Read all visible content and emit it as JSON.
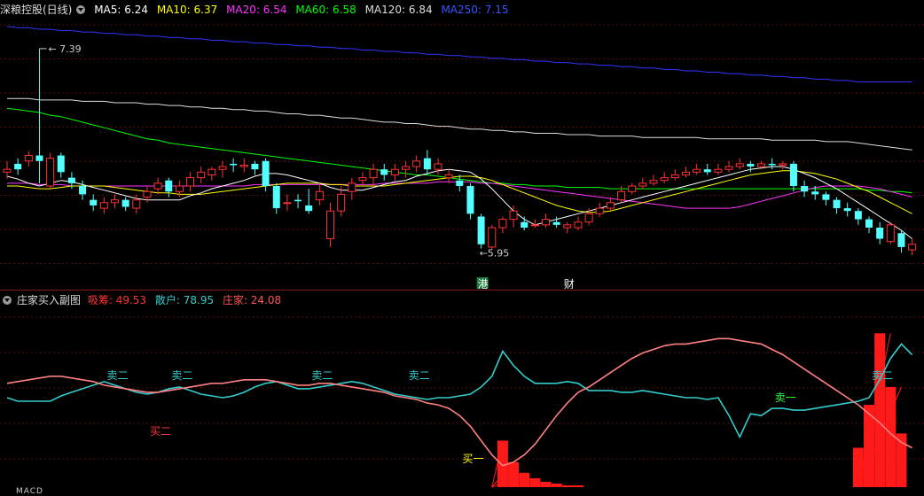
{
  "main": {
    "title": "深粮控股(日线)",
    "ma": [
      {
        "label": "MA5: 6.24",
        "color": "#ffffff"
      },
      {
        "label": "MA10: 6.37",
        "color": "#ffff00"
      },
      {
        "label": "MA20: 6.54",
        "color": "#ff33ff"
      },
      {
        "label": "MA60: 6.58",
        "color": "#00ff00"
      },
      {
        "label": "MA120: 6.84",
        "color": "#dddddd"
      },
      {
        "label": "MA250: 7.15",
        "color": "#3333ff"
      }
    ],
    "high_label": "7.39",
    "low_label": "5.95",
    "markers": [
      {
        "text": "港",
        "color": "#ffffff",
        "bg": "#1a7a3a"
      },
      {
        "text": "财",
        "color": "#ffffff",
        "bg": "#000000"
      }
    ]
  },
  "sub": {
    "title": "庄家买入副图",
    "values": [
      {
        "label": "吸筹: 49.53",
        "color": "#ff3333"
      },
      {
        "label": "散户: 78.95",
        "color": "#33cccc"
      },
      {
        "label": "庄家: 24.08",
        "color": "#ff5555"
      }
    ],
    "signals": [
      {
        "text": "卖二",
        "color": "#33cccc"
      },
      {
        "text": "卖二",
        "color": "#33cccc"
      },
      {
        "text": "卖二",
        "color": "#33cccc"
      },
      {
        "text": "卖二",
        "color": "#33cccc"
      },
      {
        "text": "卖二",
        "color": "#33cccc"
      },
      {
        "text": "卖一",
        "color": "#33ff33"
      },
      {
        "text": "买二",
        "color": "#ff3333"
      },
      {
        "text": "买一",
        "color": "#ffff00"
      }
    ]
  },
  "bottom_strip": "MACD",
  "chart_data": {
    "type": "candlestick",
    "ylim": [
      5.8,
      7.6
    ],
    "candles": [
      [
        6.5,
        6.52,
        6.58,
        6.45
      ],
      [
        6.56,
        6.52,
        6.6,
        6.48
      ],
      [
        6.58,
        6.62,
        6.65,
        6.54
      ],
      [
        6.62,
        6.58,
        7.39,
        6.42
      ],
      [
        6.4,
        6.6,
        6.64,
        6.38
      ],
      [
        6.62,
        6.5,
        6.64,
        6.46
      ],
      [
        6.46,
        6.42,
        6.5,
        6.38
      ],
      [
        6.4,
        6.34,
        6.44,
        6.3
      ],
      [
        6.3,
        6.26,
        6.34,
        6.22
      ],
      [
        6.24,
        6.28,
        6.32,
        6.2
      ],
      [
        6.28,
        6.3,
        6.34,
        6.24
      ],
      [
        6.3,
        6.25,
        6.32,
        6.22
      ],
      [
        6.24,
        6.3,
        6.34,
        6.2
      ],
      [
        6.32,
        6.36,
        6.4,
        6.28
      ],
      [
        6.38,
        6.42,
        6.46,
        6.34
      ],
      [
        6.44,
        6.36,
        6.46,
        6.32
      ],
      [
        6.36,
        6.4,
        6.44,
        6.32
      ],
      [
        6.4,
        6.46,
        6.5,
        6.36
      ],
      [
        6.46,
        6.5,
        6.54,
        6.42
      ],
      [
        6.48,
        6.52,
        6.54,
        6.44
      ],
      [
        6.52,
        6.54,
        6.58,
        6.46
      ],
      [
        6.56,
        6.55,
        6.6,
        6.5
      ],
      [
        6.54,
        6.55,
        6.6,
        6.5
      ],
      [
        6.56,
        6.52,
        6.58,
        6.48
      ],
      [
        6.58,
        6.4,
        6.6,
        6.36
      ],
      [
        6.4,
        6.24,
        6.42,
        6.2
      ],
      [
        6.28,
        6.28,
        6.34,
        6.22
      ],
      [
        6.3,
        6.29,
        6.34,
        6.24
      ],
      [
        6.26,
        6.22,
        6.38,
        6.2
      ],
      [
        6.3,
        6.36,
        6.42,
        6.26
      ],
      [
        6.02,
        6.22,
        6.28,
        5.96
      ],
      [
        6.22,
        6.34,
        6.4,
        6.18
      ],
      [
        6.36,
        6.42,
        6.46,
        6.3
      ],
      [
        6.44,
        6.46,
        6.5,
        6.4
      ],
      [
        6.46,
        6.52,
        6.56,
        6.4
      ],
      [
        6.52,
        6.48,
        6.56,
        6.44
      ],
      [
        6.48,
        6.52,
        6.56,
        6.44
      ],
      [
        6.52,
        6.54,
        6.58,
        6.46
      ],
      [
        6.54,
        6.58,
        6.62,
        6.5
      ],
      [
        6.6,
        6.52,
        6.66,
        6.48
      ],
      [
        6.52,
        6.56,
        6.6,
        6.48
      ],
      [
        6.46,
        6.48,
        6.52,
        6.42
      ],
      [
        6.44,
        6.4,
        6.48,
        6.36
      ],
      [
        6.4,
        6.2,
        6.42,
        6.16
      ],
      [
        6.18,
        5.98,
        6.2,
        5.95
      ],
      [
        5.96,
        6.1,
        6.12,
        5.94
      ],
      [
        6.1,
        6.16,
        6.18,
        6.06
      ],
      [
        6.16,
        6.22,
        6.26,
        6.1
      ],
      [
        6.14,
        6.1,
        6.18,
        6.08
      ],
      [
        6.12,
        6.12,
        6.16,
        6.1
      ],
      [
        6.12,
        6.16,
        6.2,
        6.1
      ],
      [
        6.14,
        6.12,
        6.18,
        6.1
      ],
      [
        6.1,
        6.12,
        6.14,
        6.06
      ],
      [
        6.1,
        6.14,
        6.18,
        6.08
      ],
      [
        6.14,
        6.2,
        6.24,
        6.12
      ],
      [
        6.2,
        6.24,
        6.28,
        6.18
      ],
      [
        6.24,
        6.28,
        6.32,
        6.22
      ],
      [
        6.3,
        6.36,
        6.4,
        6.28
      ],
      [
        6.36,
        6.4,
        6.42,
        6.34
      ],
      [
        6.4,
        6.42,
        6.46,
        6.38
      ],
      [
        6.42,
        6.44,
        6.48,
        6.4
      ],
      [
        6.44,
        6.46,
        6.5,
        6.42
      ],
      [
        6.46,
        6.48,
        6.52,
        6.44
      ],
      [
        6.48,
        6.5,
        6.54,
        6.46
      ],
      [
        6.5,
        6.52,
        6.56,
        6.48
      ],
      [
        6.52,
        6.5,
        6.56,
        6.48
      ],
      [
        6.5,
        6.52,
        6.56,
        6.48
      ],
      [
        6.52,
        6.54,
        6.58,
        6.5
      ],
      [
        6.54,
        6.56,
        6.6,
        6.52
      ],
      [
        6.56,
        6.54,
        6.58,
        6.5
      ],
      [
        6.54,
        6.56,
        6.58,
        6.52
      ],
      [
        6.56,
        6.55,
        6.6,
        6.52
      ],
      [
        6.55,
        6.56,
        6.58,
        6.52
      ],
      [
        6.56,
        6.4,
        6.58,
        6.36
      ],
      [
        6.4,
        6.36,
        6.44,
        6.32
      ],
      [
        6.36,
        6.34,
        6.4,
        6.3
      ],
      [
        6.34,
        6.3,
        6.36,
        6.26
      ],
      [
        6.3,
        6.24,
        6.32,
        6.2
      ],
      [
        6.24,
        6.22,
        6.28,
        6.18
      ],
      [
        6.22,
        6.16,
        6.24,
        6.12
      ],
      [
        6.16,
        6.1,
        6.18,
        6.06
      ],
      [
        6.1,
        6.02,
        6.14,
        5.98
      ],
      [
        6.0,
        6.12,
        6.14,
        5.98
      ],
      [
        6.06,
        5.96,
        6.08,
        5.92
      ],
      [
        5.94,
        5.98,
        6.02,
        5.9
      ]
    ],
    "ma_series": [
      {
        "name": "MA5",
        "color": "#ffffff",
        "values": [
          6.47,
          6.45,
          6.42,
          6.4,
          6.42,
          6.44,
          6.43,
          6.41,
          6.39,
          6.37,
          6.35,
          6.33,
          6.31,
          6.3,
          6.3,
          6.3,
          6.3,
          6.33,
          6.35,
          6.38,
          6.4,
          6.42,
          6.44,
          6.47,
          6.49,
          6.49,
          6.48,
          6.46,
          6.44,
          6.42,
          6.39,
          6.37,
          6.37,
          6.37,
          6.39,
          6.41,
          6.43,
          6.44,
          6.47,
          6.49,
          6.51,
          6.52,
          6.51,
          6.5,
          6.45,
          6.38,
          6.3,
          6.22,
          6.16,
          6.12,
          6.14,
          6.16,
          6.18,
          6.2,
          6.22,
          6.24,
          6.26,
          6.28,
          6.3,
          6.32,
          6.34,
          6.36,
          6.38,
          6.4,
          6.42,
          6.44,
          6.46,
          6.48,
          6.5,
          6.52,
          6.53,
          6.54,
          6.54,
          6.52,
          6.49,
          6.46,
          6.42,
          6.38,
          6.33,
          6.28,
          6.23,
          6.18,
          6.13,
          6.08,
          6.02
        ]
      },
      {
        "name": "MA10",
        "color": "#ffff00",
        "values": [
          6.4,
          6.4,
          6.39,
          6.38,
          6.38,
          6.39,
          6.4,
          6.4,
          6.4,
          6.4,
          6.39,
          6.38,
          6.37,
          6.36,
          6.35,
          6.35,
          6.34,
          6.34,
          6.34,
          6.35,
          6.36,
          6.37,
          6.38,
          6.39,
          6.4,
          6.41,
          6.42,
          6.42,
          6.42,
          6.42,
          6.41,
          6.41,
          6.4,
          6.4,
          6.4,
          6.4,
          6.41,
          6.42,
          6.43,
          6.44,
          6.45,
          6.46,
          6.47,
          6.47,
          6.46,
          6.44,
          6.41,
          6.38,
          6.35,
          6.32,
          6.29,
          6.26,
          6.24,
          6.22,
          6.21,
          6.21,
          6.22,
          6.24,
          6.26,
          6.28,
          6.3,
          6.32,
          6.34,
          6.36,
          6.38,
          6.4,
          6.42,
          6.44,
          6.46,
          6.48,
          6.49,
          6.5,
          6.51,
          6.51,
          6.5,
          6.49,
          6.47,
          6.45,
          6.42,
          6.39,
          6.36,
          6.32,
          6.28,
          6.24,
          6.2
        ]
      },
      {
        "name": "MA20",
        "color": "#ff33ff",
        "values": [
          6.42,
          6.42,
          6.42,
          6.41,
          6.41,
          6.41,
          6.4,
          6.4,
          6.4,
          6.4,
          6.4,
          6.4,
          6.4,
          6.4,
          6.4,
          6.4,
          6.4,
          6.4,
          6.4,
          6.4,
          6.4,
          6.4,
          6.4,
          6.41,
          6.41,
          6.41,
          6.41,
          6.41,
          6.41,
          6.41,
          6.41,
          6.41,
          6.41,
          6.41,
          6.41,
          6.42,
          6.42,
          6.42,
          6.42,
          6.42,
          6.43,
          6.43,
          6.43,
          6.43,
          6.42,
          6.42,
          6.41,
          6.4,
          6.39,
          6.38,
          6.37,
          6.36,
          6.35,
          6.34,
          6.33,
          6.32,
          6.31,
          6.3,
          6.29,
          6.28,
          6.27,
          6.26,
          6.25,
          6.24,
          6.24,
          6.24,
          6.24,
          6.24,
          6.25,
          6.27,
          6.29,
          6.31,
          6.33,
          6.35,
          6.37,
          6.39,
          6.4,
          6.4,
          6.4,
          6.4,
          6.39,
          6.38,
          6.36,
          6.34,
          6.32
        ]
      },
      {
        "name": "MA60",
        "color": "#00ff00",
        "values": [
          6.96,
          6.95,
          6.94,
          6.93,
          6.91,
          6.9,
          6.88,
          6.86,
          6.84,
          6.82,
          6.8,
          6.78,
          6.76,
          6.74,
          6.73,
          6.71,
          6.7,
          6.69,
          6.68,
          6.67,
          6.66,
          6.65,
          6.64,
          6.63,
          6.62,
          6.61,
          6.6,
          6.59,
          6.58,
          6.57,
          6.56,
          6.55,
          6.54,
          6.53,
          6.52,
          6.51,
          6.5,
          6.49,
          6.48,
          6.48,
          6.47,
          6.46,
          6.45,
          6.44,
          6.43,
          6.42,
          6.42,
          6.41,
          6.41,
          6.4,
          6.4,
          6.4,
          6.39,
          6.39,
          6.39,
          6.39,
          6.38,
          6.38,
          6.38,
          6.38,
          6.38,
          6.38,
          6.38,
          6.38,
          6.38,
          6.38,
          6.38,
          6.38,
          6.38,
          6.38,
          6.38,
          6.38,
          6.38,
          6.38,
          6.38,
          6.38,
          6.38,
          6.38,
          6.38,
          6.38,
          6.37,
          6.37,
          6.36,
          6.36,
          6.35
        ]
      },
      {
        "name": "MA120",
        "color": "#dddddd",
        "values": [
          7.03,
          7.03,
          7.03,
          7.02,
          7.02,
          7.02,
          7.02,
          7.01,
          7.01,
          7.01,
          7.0,
          7.0,
          7.0,
          6.99,
          6.99,
          6.98,
          6.98,
          6.97,
          6.97,
          6.96,
          6.96,
          6.95,
          6.95,
          6.94,
          6.94,
          6.93,
          6.92,
          6.92,
          6.91,
          6.91,
          6.9,
          6.89,
          6.89,
          6.88,
          6.87,
          6.86,
          6.86,
          6.85,
          6.85,
          6.84,
          6.83,
          6.83,
          6.82,
          6.81,
          6.81,
          6.8,
          6.8,
          6.79,
          6.79,
          6.78,
          6.78,
          6.78,
          6.77,
          6.77,
          6.77,
          6.76,
          6.76,
          6.76,
          6.76,
          6.75,
          6.75,
          6.75,
          6.75,
          6.75,
          6.75,
          6.74,
          6.74,
          6.74,
          6.74,
          6.74,
          6.74,
          6.73,
          6.73,
          6.73,
          6.73,
          6.73,
          6.72,
          6.72,
          6.72,
          6.71,
          6.7,
          6.69,
          6.68,
          6.67,
          6.66
        ]
      },
      {
        "name": "MA250",
        "color": "#3333ff",
        "values": [
          7.55,
          7.54,
          7.54,
          7.53,
          7.53,
          7.52,
          7.52,
          7.51,
          7.51,
          7.5,
          7.5,
          7.49,
          7.49,
          7.48,
          7.48,
          7.47,
          7.47,
          7.46,
          7.46,
          7.45,
          7.45,
          7.44,
          7.44,
          7.43,
          7.43,
          7.42,
          7.42,
          7.41,
          7.41,
          7.4,
          7.4,
          7.39,
          7.39,
          7.38,
          7.38,
          7.37,
          7.37,
          7.36,
          7.36,
          7.35,
          7.35,
          7.34,
          7.34,
          7.33,
          7.33,
          7.32,
          7.32,
          7.31,
          7.31,
          7.3,
          7.3,
          7.29,
          7.29,
          7.28,
          7.28,
          7.27,
          7.27,
          7.26,
          7.26,
          7.25,
          7.25,
          7.24,
          7.24,
          7.23,
          7.23,
          7.22,
          7.22,
          7.21,
          7.21,
          7.2,
          7.2,
          7.19,
          7.19,
          7.18,
          7.18,
          7.17,
          7.17,
          7.16,
          7.16,
          7.15,
          7.15,
          7.15,
          7.15,
          7.15,
          7.15
        ]
      }
    ],
    "sub_ylim": [
      0,
      100
    ],
    "sanhu": [
      50,
      48,
      48,
      48,
      48,
      51,
      53,
      55,
      57,
      59,
      57,
      55,
      53,
      52,
      53,
      55,
      56,
      54,
      52,
      51,
      50,
      51,
      53,
      56,
      58,
      59,
      57,
      55,
      55,
      56,
      57,
      58,
      59,
      58,
      56,
      54,
      52,
      51,
      50,
      49,
      50,
      50,
      51,
      52,
      56,
      62,
      76,
      68,
      62,
      58,
      58,
      58,
      59,
      58,
      54,
      54,
      54,
      53,
      53,
      54,
      53,
      52,
      51,
      50,
      50,
      49,
      50,
      40,
      28,
      41,
      40,
      44,
      44,
      43,
      43,
      44,
      45,
      46,
      47,
      48,
      50,
      60,
      72,
      80,
      74
    ],
    "zhuangjia": [
      58,
      59,
      60,
      61,
      62,
      62,
      61,
      60,
      59,
      57,
      56,
      55,
      54,
      53,
      53,
      54,
      55,
      56,
      57,
      58,
      58,
      59,
      60,
      60,
      60,
      59,
      58,
      57,
      57,
      58,
      58,
      57,
      56,
      55,
      54,
      53,
      51,
      50,
      49,
      47,
      46,
      44,
      40,
      34,
      26,
      18,
      12,
      14,
      18,
      24,
      32,
      40,
      47,
      53,
      56,
      60,
      64,
      68,
      72,
      75,
      77,
      79,
      80,
      80,
      81,
      82,
      83,
      83,
      82,
      81,
      80,
      77,
      74,
      70,
      66,
      62,
      58,
      54,
      50,
      46,
      41,
      36,
      30,
      25,
      22
    ],
    "xichou": [
      0,
      0,
      0,
      0,
      0,
      0,
      0,
      0,
      0,
      0,
      0,
      0,
      0,
      0,
      0,
      0,
      0,
      0,
      0,
      0,
      0,
      0,
      0,
      0,
      0,
      0,
      0,
      0,
      0,
      0,
      0,
      0,
      0,
      0,
      0,
      0,
      0,
      0,
      0,
      0,
      0,
      0,
      0,
      0,
      0,
      0,
      26,
      14,
      8,
      5,
      3,
      2,
      1,
      1,
      0,
      0,
      0,
      0,
      0,
      0,
      0,
      0,
      0,
      0,
      0,
      0,
      0,
      0,
      0,
      0,
      0,
      0,
      0,
      0,
      0,
      0,
      0,
      0,
      0,
      22,
      46,
      86,
      56,
      30,
      0
    ]
  }
}
